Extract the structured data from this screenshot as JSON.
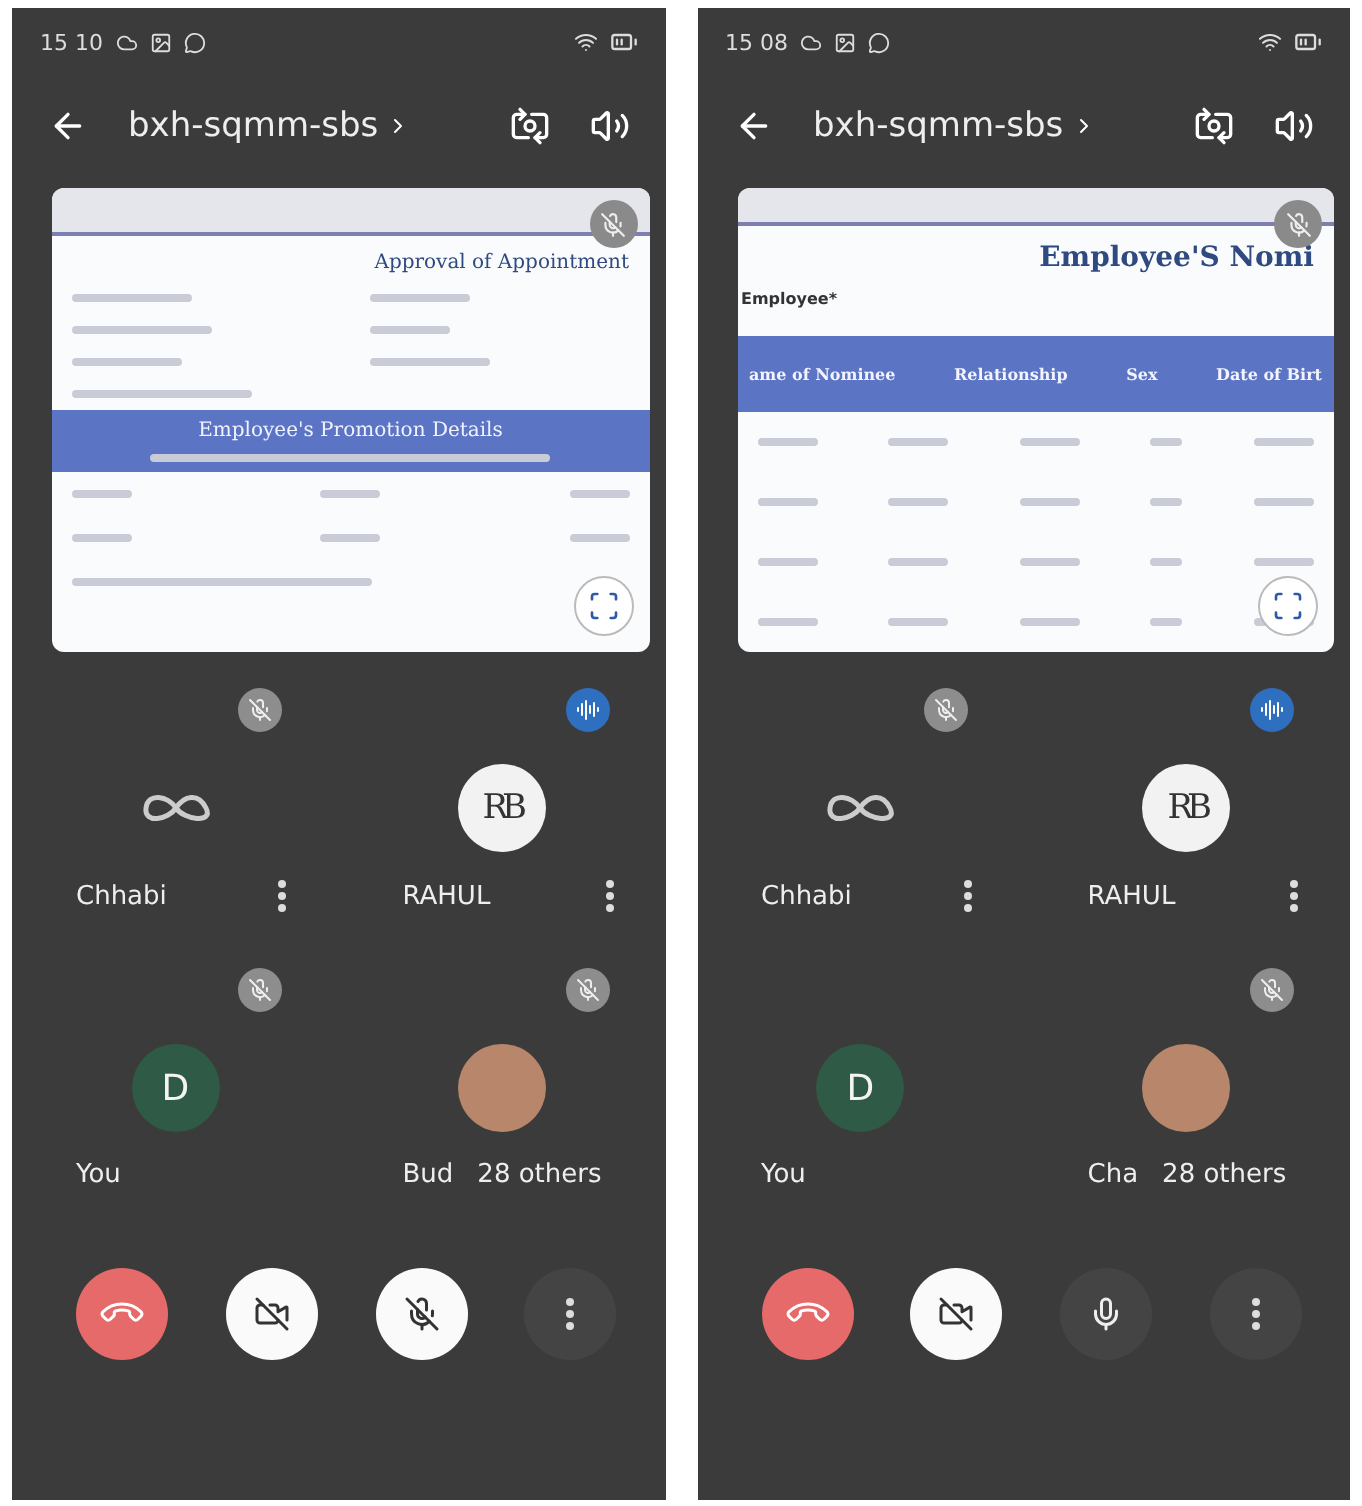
{
  "phones": [
    {
      "status_time": "15 10",
      "title": "bxh-sqmm-sbs",
      "shared_screen": {
        "kind": "form",
        "muted": true,
        "heading": "Approval of Appointment",
        "bar_title": "Employee's Promotion Details"
      },
      "participants": [
        {
          "name": "Chhabi",
          "kind": "infinity",
          "muted": true,
          "speaking": false,
          "menu": true
        },
        {
          "name": "RAHUL",
          "kind": "monogram",
          "letters": "RB",
          "muted": false,
          "speaking": true,
          "menu": true
        },
        {
          "name": "You",
          "kind": "initial",
          "letters": "D",
          "muted": true,
          "speaking": false,
          "menu": false
        },
        {
          "name": "Bud",
          "others": "28 others",
          "kind": "photo",
          "muted": true,
          "speaking": false,
          "menu": false
        }
      ],
      "controls": {
        "camera_off": true,
        "mic_muted": true
      }
    },
    {
      "status_time": "15 08",
      "title": "bxh-sqmm-sbs",
      "shared_screen": {
        "kind": "table",
        "muted": true,
        "heading": "Employee'S Nomi",
        "field_label": "Employee*",
        "columns": [
          "ame of Nominee",
          "Relationship",
          "Sex",
          "Date of Birt"
        ]
      },
      "participants": [
        {
          "name": "Chhabi",
          "kind": "infinity",
          "muted": true,
          "speaking": false,
          "menu": true
        },
        {
          "name": "RAHUL",
          "kind": "monogram",
          "letters": "RB",
          "muted": false,
          "speaking": true,
          "menu": true
        },
        {
          "name": "You",
          "kind": "initial",
          "letters": "D",
          "muted": false,
          "speaking": false,
          "menu": false
        },
        {
          "name": "Cha",
          "others": "28 others",
          "kind": "photo",
          "muted": true,
          "speaking": false,
          "menu": false
        }
      ],
      "controls": {
        "camera_off": true,
        "mic_muted": false
      }
    }
  ]
}
